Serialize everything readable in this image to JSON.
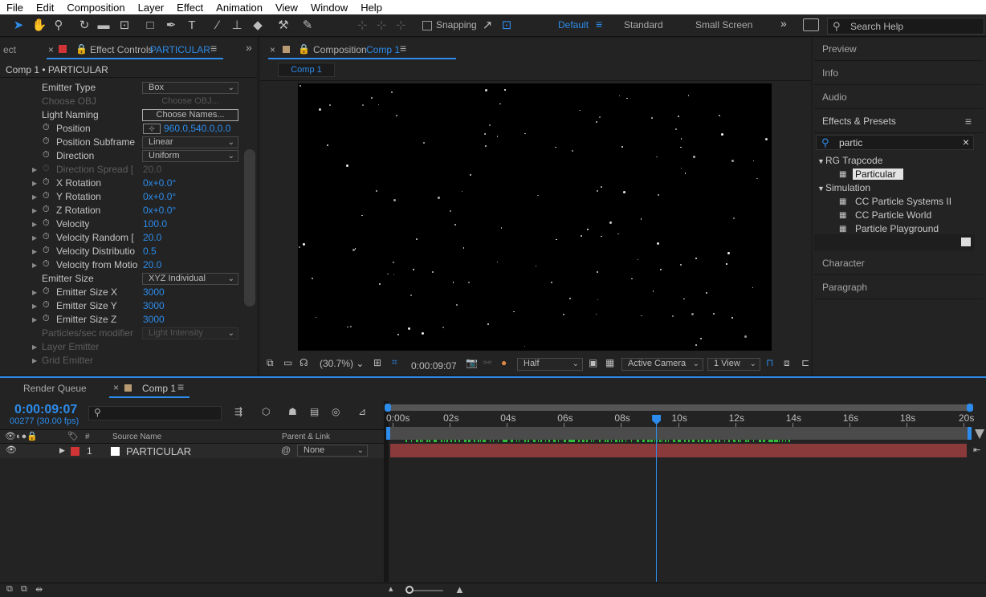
{
  "menu": [
    "File",
    "Edit",
    "Composition",
    "Layer",
    "Effect",
    "Animation",
    "View",
    "Window",
    "Help"
  ],
  "toolbar": {
    "snapping_label": "Snapping",
    "workspaces": [
      "Default",
      "Standard",
      "Small Screen"
    ],
    "search_placeholder": "Search Help"
  },
  "effect_controls": {
    "tab_cut": "ect",
    "tab_title": "Effect Controls",
    "tab_layer": "PARTICULAR",
    "breadcrumb": "Comp 1 • PARTICULAR",
    "props": [
      {
        "label": "Emitter Type",
        "kind": "select",
        "value": "Box"
      },
      {
        "label": "Choose OBJ",
        "kind": "button",
        "value": "Choose OBJ...",
        "disabled": true
      },
      {
        "label": "Light Naming",
        "kind": "button",
        "value": "Choose Names..."
      },
      {
        "label": "Position",
        "kind": "point",
        "value": "960.0,540.0,0.0"
      },
      {
        "label": "Position Subframe",
        "kind": "select",
        "value": "Linear"
      },
      {
        "label": "Direction",
        "kind": "select",
        "value": "Uniform"
      },
      {
        "label": "Direction Spread [",
        "kind": "value",
        "value": "20.0",
        "disabled": true
      },
      {
        "label": "X Rotation",
        "kind": "value",
        "value": "0x+0.0°"
      },
      {
        "label": "Y Rotation",
        "kind": "value",
        "value": "0x+0.0°"
      },
      {
        "label": "Z Rotation",
        "kind": "value",
        "value": "0x+0.0°"
      },
      {
        "label": "Velocity",
        "kind": "value",
        "value": "100.0"
      },
      {
        "label": "Velocity Random [",
        "kind": "value",
        "value": "20.0"
      },
      {
        "label": "Velocity Distributio",
        "kind": "value",
        "value": "0.5"
      },
      {
        "label": "Velocity from Motio",
        "kind": "value",
        "value": "20.0"
      },
      {
        "label": "Emitter Size",
        "kind": "select",
        "value": "XYZ Individual"
      },
      {
        "label": "Emitter Size X",
        "kind": "value",
        "value": "3000"
      },
      {
        "label": "Emitter Size Y",
        "kind": "value",
        "value": "3000"
      },
      {
        "label": "Emitter Size Z",
        "kind": "value",
        "value": "3000"
      },
      {
        "label": "Particles/sec modifier",
        "kind": "select",
        "value": "Light Intensity",
        "disabled": true
      },
      {
        "label": "Layer Emitter",
        "kind": "group",
        "disabled": true
      },
      {
        "label": "Grid Emitter",
        "kind": "group",
        "disabled": true
      }
    ]
  },
  "composition": {
    "tab_title": "Composition",
    "tab_comp": "Comp 1",
    "subtab": "Comp 1",
    "zoom": "(30.7%)",
    "timecode": "0:00:09:07",
    "resolution": "Half",
    "camera": "Active Camera",
    "views": "1 View"
  },
  "right_panels": {
    "preview": "Preview",
    "info": "Info",
    "audio": "Audio",
    "effects_presets": "Effects & Presets",
    "search_value": "partic",
    "groups": [
      {
        "name": "RG Trapcode",
        "items": [
          "Particular"
        ]
      },
      {
        "name": "Simulation",
        "items": [
          "CC Particle Systems II",
          "CC Particle World",
          "Particle Playground"
        ]
      }
    ],
    "character": "Character",
    "paragraph": "Paragraph"
  },
  "timeline": {
    "render_queue_tab": "Render Queue",
    "comp_tab": "Comp 1",
    "timecode": "0:00:09:07",
    "frame_info": "00277 (30.00 fps)",
    "search_placeholder": "",
    "col_hash": "#",
    "col_source": "Source Name",
    "col_parent": "Parent & Link",
    "layer_num": "1",
    "layer_name": "PARTICULAR",
    "parent_value": "None",
    "ticks": [
      "0:00s",
      "02s",
      "04s",
      "06s",
      "08s",
      "10s",
      "12s",
      "14s",
      "16s",
      "18s",
      "20s"
    ],
    "playhead_seconds": 9.23,
    "duration_seconds": 20
  },
  "colors": {
    "accent": "#2d8ceb",
    "layer_label": "#d03434",
    "layer_bar": "#8a3a3a"
  }
}
